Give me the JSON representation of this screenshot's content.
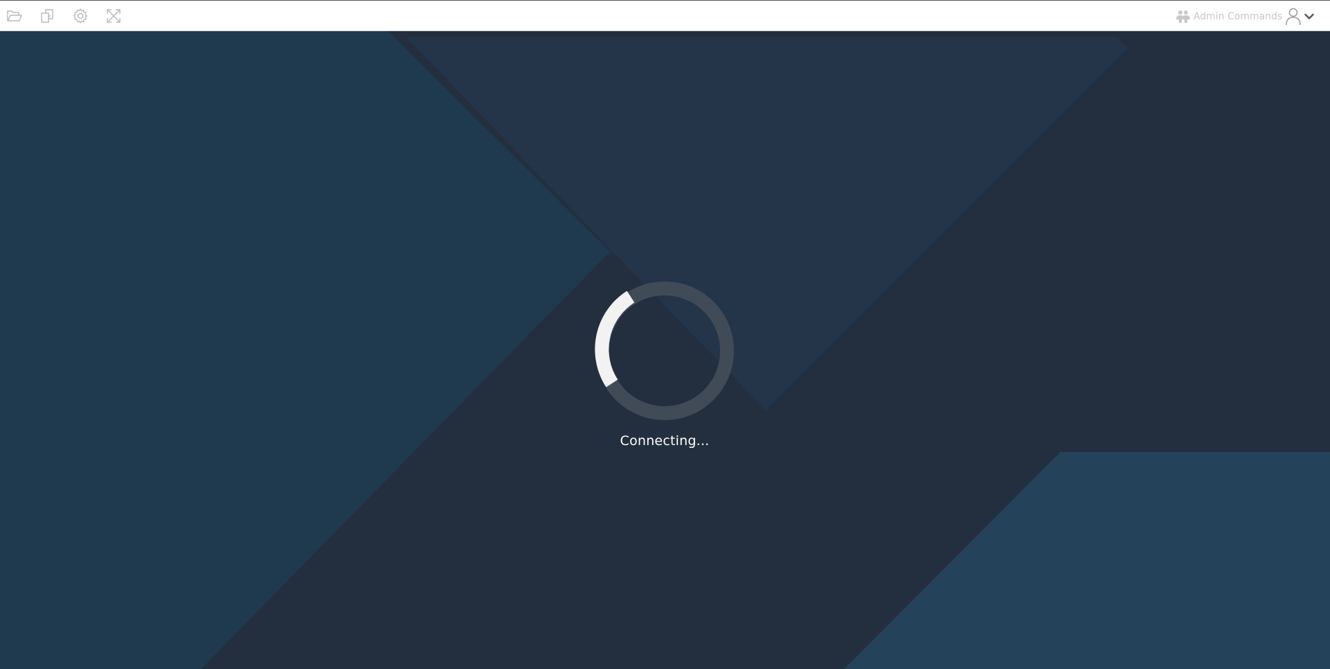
{
  "toolbar": {
    "buttons": [
      {
        "name": "folder-button",
        "icon": "folder-open-icon"
      },
      {
        "name": "clipboard-button",
        "icon": "copy-icon"
      },
      {
        "name": "settings-button",
        "icon": "gear-icon"
      },
      {
        "name": "fullscreen-button",
        "icon": "expand-arrows-icon"
      }
    ],
    "admin_commands_label": "Admin Commands",
    "admin_icon": "users-icon",
    "user_icon": "user-icon",
    "user_menu_icon": "chevron-down-icon"
  },
  "status": {
    "text": "Connecting..."
  },
  "colors": {
    "background": "#232f3e",
    "panel_left": "#1f3a4f",
    "panel_top": "#243449",
    "panel_bottom_right": "#24435a",
    "spinner_track": "#414b58",
    "spinner_arc": "#f2f2f2",
    "toolbar_icon": "#b8b8b8"
  }
}
